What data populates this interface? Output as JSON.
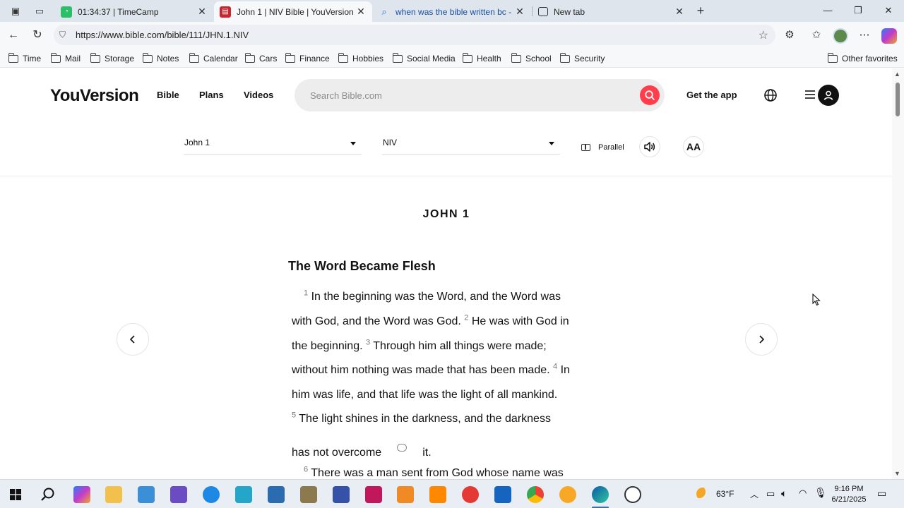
{
  "browser": {
    "tabs": [
      {
        "title": "01:34:37 | TimeCamp",
        "active": false
      },
      {
        "title": "John 1 | NIV Bible | YouVersion",
        "active": true
      },
      {
        "title": "when was the bible written bc - Se",
        "active": false
      },
      {
        "title": "New tab",
        "active": false
      }
    ],
    "url": "https://www.bible.com/bible/111/JHN.1.NIV",
    "favorites": [
      "Time",
      "Mail",
      "Storage",
      "Notes",
      "Calendar",
      "Cars",
      "Finance",
      "Hobbies",
      "Social Media",
      "Health",
      "School",
      "Security"
    ],
    "other_favorites": "Other favorites"
  },
  "site": {
    "logo": "YouVersion",
    "nav": [
      "Bible",
      "Plans",
      "Videos"
    ],
    "search_placeholder": "Search Bible.com",
    "get_app": "Get the app",
    "colors": {
      "accent": "#ff3d4d",
      "text": "#121212"
    }
  },
  "reader": {
    "book_selector": "John 1",
    "version_selector": "NIV",
    "parallel_label": "Parallel",
    "font_button": "AA",
    "chapter_title": "JOHN 1",
    "section_heading": "The Word Became Flesh",
    "lines": [
      {
        "vn": "1",
        "text": "In the beginning was the Word, and the Word was"
      },
      {
        "text": "with God, and the Word was God.",
        "vn2": "2",
        "text2": "He was with God in"
      },
      {
        "text": "the beginning.",
        "vn2": "3",
        "text2": "Through him all things were made;"
      },
      {
        "text": "without him nothing was made that has been made.",
        "vn2": "4",
        "text2": "In"
      },
      {
        "text": "him was life, and that life was the light of all mankind."
      },
      {
        "vn": "5",
        "text": "The light shines in the darkness, and the darkness"
      },
      {
        "text": "has not overcome",
        "text2": "it."
      },
      {
        "vn": "6",
        "text": "There was a man sent from God whose name was"
      }
    ]
  },
  "taskbar": {
    "weather": "63°F",
    "time": "9:16 PM",
    "date": "6/21/2025"
  }
}
